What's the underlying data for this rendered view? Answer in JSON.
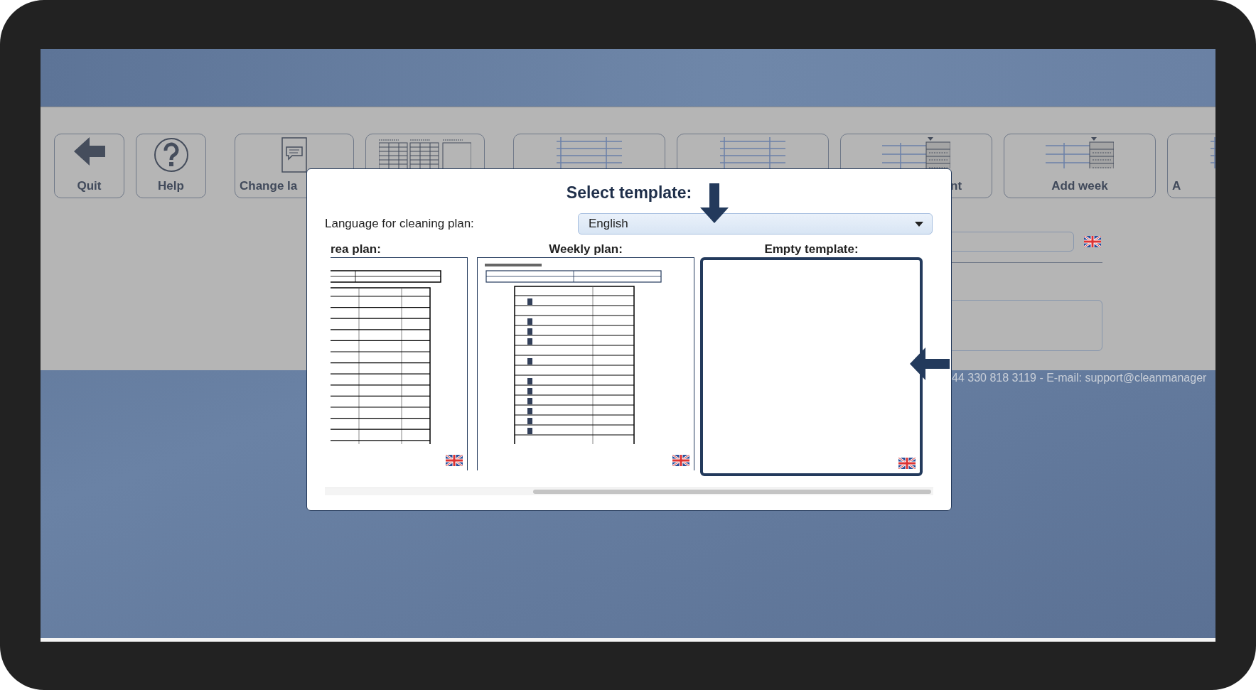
{
  "toolbar": {
    "buttons": [
      {
        "label": "Quit",
        "kind": "quit"
      },
      {
        "label": "Help",
        "kind": "help"
      },
      {
        "label": "Change la",
        "kind": "language",
        "label_cut_right": true
      },
      {
        "kind": "plans"
      },
      {
        "kind": "table"
      },
      {
        "kind": "table"
      },
      {
        "label": "nt",
        "kind": "week",
        "label_cut_left": true
      },
      {
        "label": "Add week",
        "kind": "week"
      },
      {
        "label": "A",
        "kind": "table",
        "label_cut_right": true
      }
    ]
  },
  "background": {
    "footer_text": "44 330 818 3119 - E-mail: support@cleanmanager"
  },
  "dialog": {
    "title": "Select template:",
    "language_label": "Language for cleaning plan:",
    "language_select": {
      "value": "English"
    },
    "templates": [
      {
        "label": "rea plan:",
        "kind": "area",
        "selected": false
      },
      {
        "label": "Weekly plan:",
        "kind": "weekly",
        "selected": false
      },
      {
        "label": "Empty template:",
        "kind": "empty",
        "selected": true
      }
    ]
  }
}
